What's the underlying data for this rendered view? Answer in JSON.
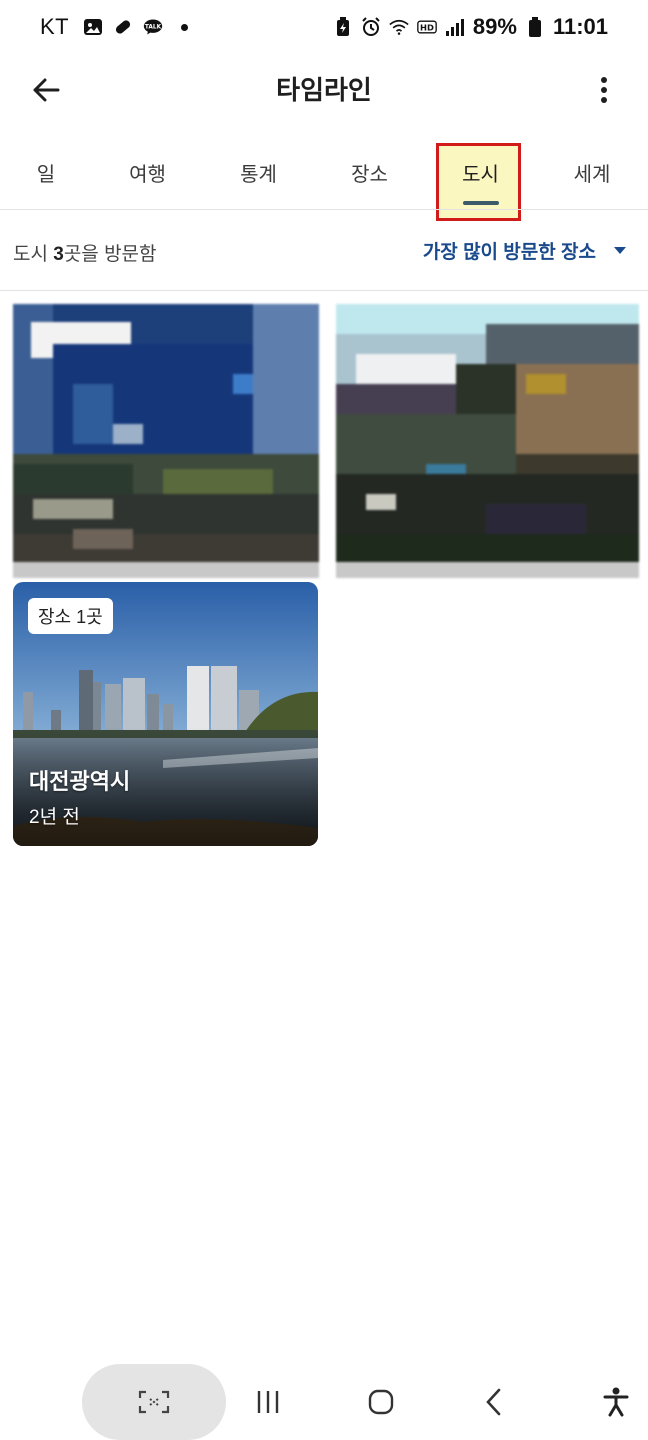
{
  "status_bar": {
    "carrier": "KT",
    "battery": "89%",
    "time": "11:01"
  },
  "app_bar": {
    "title": "타임라인"
  },
  "tabs": [
    {
      "label": "일"
    },
    {
      "label": "여행"
    },
    {
      "label": "통계"
    },
    {
      "label": "장소"
    },
    {
      "label": "도시",
      "active": true
    },
    {
      "label": "세계"
    }
  ],
  "summary": {
    "prefix": "도시 ",
    "count": "3",
    "suffix": "곳을 방문함"
  },
  "sort": {
    "label": "가장 많이 방문한 장소"
  },
  "cards": [
    {
      "image": "blurred-city-photo-1"
    },
    {
      "image": "blurred-city-photo-2"
    },
    {
      "badge": "장소 1곳",
      "name": "대전광역시",
      "when": "2년 전",
      "image": "river-city-skyline"
    }
  ],
  "colors": {
    "accent_blue": "#1a4a8c",
    "tab_indicator": "#3d5a6b",
    "highlight_fill": "#fbf7c0",
    "highlight_border": "#d11a1a"
  }
}
